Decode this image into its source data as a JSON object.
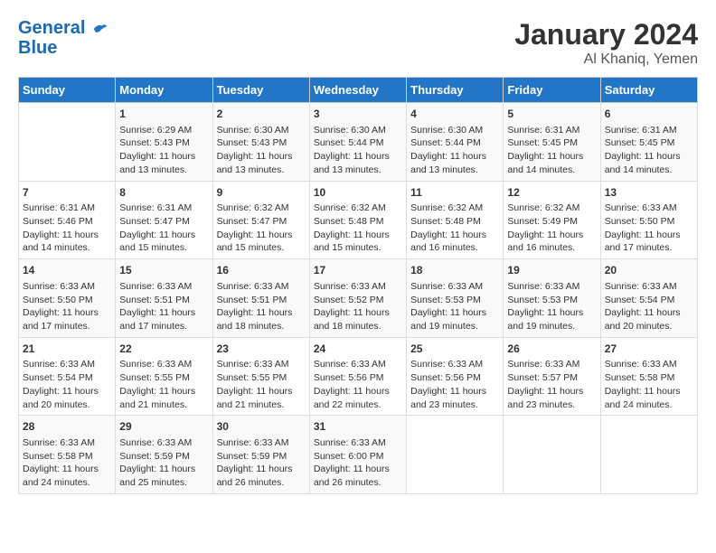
{
  "header": {
    "logo_line1": "General",
    "logo_line2": "Blue",
    "title": "January 2024",
    "subtitle": "Al Khaniq, Yemen"
  },
  "weekdays": [
    "Sunday",
    "Monday",
    "Tuesday",
    "Wednesday",
    "Thursday",
    "Friday",
    "Saturday"
  ],
  "weeks": [
    [
      {
        "day": "",
        "sunrise": "",
        "sunset": "",
        "daylight": ""
      },
      {
        "day": "1",
        "sunrise": "Sunrise: 6:29 AM",
        "sunset": "Sunset: 5:43 PM",
        "daylight": "Daylight: 11 hours and 13 minutes."
      },
      {
        "day": "2",
        "sunrise": "Sunrise: 6:30 AM",
        "sunset": "Sunset: 5:43 PM",
        "daylight": "Daylight: 11 hours and 13 minutes."
      },
      {
        "day": "3",
        "sunrise": "Sunrise: 6:30 AM",
        "sunset": "Sunset: 5:44 PM",
        "daylight": "Daylight: 11 hours and 13 minutes."
      },
      {
        "day": "4",
        "sunrise": "Sunrise: 6:30 AM",
        "sunset": "Sunset: 5:44 PM",
        "daylight": "Daylight: 11 hours and 13 minutes."
      },
      {
        "day": "5",
        "sunrise": "Sunrise: 6:31 AM",
        "sunset": "Sunset: 5:45 PM",
        "daylight": "Daylight: 11 hours and 14 minutes."
      },
      {
        "day": "6",
        "sunrise": "Sunrise: 6:31 AM",
        "sunset": "Sunset: 5:45 PM",
        "daylight": "Daylight: 11 hours and 14 minutes."
      }
    ],
    [
      {
        "day": "7",
        "sunrise": "Sunrise: 6:31 AM",
        "sunset": "Sunset: 5:46 PM",
        "daylight": "Daylight: 11 hours and 14 minutes."
      },
      {
        "day": "8",
        "sunrise": "Sunrise: 6:31 AM",
        "sunset": "Sunset: 5:47 PM",
        "daylight": "Daylight: 11 hours and 15 minutes."
      },
      {
        "day": "9",
        "sunrise": "Sunrise: 6:32 AM",
        "sunset": "Sunset: 5:47 PM",
        "daylight": "Daylight: 11 hours and 15 minutes."
      },
      {
        "day": "10",
        "sunrise": "Sunrise: 6:32 AM",
        "sunset": "Sunset: 5:48 PM",
        "daylight": "Daylight: 11 hours and 15 minutes."
      },
      {
        "day": "11",
        "sunrise": "Sunrise: 6:32 AM",
        "sunset": "Sunset: 5:48 PM",
        "daylight": "Daylight: 11 hours and 16 minutes."
      },
      {
        "day": "12",
        "sunrise": "Sunrise: 6:32 AM",
        "sunset": "Sunset: 5:49 PM",
        "daylight": "Daylight: 11 hours and 16 minutes."
      },
      {
        "day": "13",
        "sunrise": "Sunrise: 6:33 AM",
        "sunset": "Sunset: 5:50 PM",
        "daylight": "Daylight: 11 hours and 17 minutes."
      }
    ],
    [
      {
        "day": "14",
        "sunrise": "Sunrise: 6:33 AM",
        "sunset": "Sunset: 5:50 PM",
        "daylight": "Daylight: 11 hours and 17 minutes."
      },
      {
        "day": "15",
        "sunrise": "Sunrise: 6:33 AM",
        "sunset": "Sunset: 5:51 PM",
        "daylight": "Daylight: 11 hours and 17 minutes."
      },
      {
        "day": "16",
        "sunrise": "Sunrise: 6:33 AM",
        "sunset": "Sunset: 5:51 PM",
        "daylight": "Daylight: 11 hours and 18 minutes."
      },
      {
        "day": "17",
        "sunrise": "Sunrise: 6:33 AM",
        "sunset": "Sunset: 5:52 PM",
        "daylight": "Daylight: 11 hours and 18 minutes."
      },
      {
        "day": "18",
        "sunrise": "Sunrise: 6:33 AM",
        "sunset": "Sunset: 5:53 PM",
        "daylight": "Daylight: 11 hours and 19 minutes."
      },
      {
        "day": "19",
        "sunrise": "Sunrise: 6:33 AM",
        "sunset": "Sunset: 5:53 PM",
        "daylight": "Daylight: 11 hours and 19 minutes."
      },
      {
        "day": "20",
        "sunrise": "Sunrise: 6:33 AM",
        "sunset": "Sunset: 5:54 PM",
        "daylight": "Daylight: 11 hours and 20 minutes."
      }
    ],
    [
      {
        "day": "21",
        "sunrise": "Sunrise: 6:33 AM",
        "sunset": "Sunset: 5:54 PM",
        "daylight": "Daylight: 11 hours and 20 minutes."
      },
      {
        "day": "22",
        "sunrise": "Sunrise: 6:33 AM",
        "sunset": "Sunset: 5:55 PM",
        "daylight": "Daylight: 11 hours and 21 minutes."
      },
      {
        "day": "23",
        "sunrise": "Sunrise: 6:33 AM",
        "sunset": "Sunset: 5:55 PM",
        "daylight": "Daylight: 11 hours and 21 minutes."
      },
      {
        "day": "24",
        "sunrise": "Sunrise: 6:33 AM",
        "sunset": "Sunset: 5:56 PM",
        "daylight": "Daylight: 11 hours and 22 minutes."
      },
      {
        "day": "25",
        "sunrise": "Sunrise: 6:33 AM",
        "sunset": "Sunset: 5:56 PM",
        "daylight": "Daylight: 11 hours and 23 minutes."
      },
      {
        "day": "26",
        "sunrise": "Sunrise: 6:33 AM",
        "sunset": "Sunset: 5:57 PM",
        "daylight": "Daylight: 11 hours and 23 minutes."
      },
      {
        "day": "27",
        "sunrise": "Sunrise: 6:33 AM",
        "sunset": "Sunset: 5:58 PM",
        "daylight": "Daylight: 11 hours and 24 minutes."
      }
    ],
    [
      {
        "day": "28",
        "sunrise": "Sunrise: 6:33 AM",
        "sunset": "Sunset: 5:58 PM",
        "daylight": "Daylight: 11 hours and 24 minutes."
      },
      {
        "day": "29",
        "sunrise": "Sunrise: 6:33 AM",
        "sunset": "Sunset: 5:59 PM",
        "daylight": "Daylight: 11 hours and 25 minutes."
      },
      {
        "day": "30",
        "sunrise": "Sunrise: 6:33 AM",
        "sunset": "Sunset: 5:59 PM",
        "daylight": "Daylight: 11 hours and 26 minutes."
      },
      {
        "day": "31",
        "sunrise": "Sunrise: 6:33 AM",
        "sunset": "Sunset: 6:00 PM",
        "daylight": "Daylight: 11 hours and 26 minutes."
      },
      {
        "day": "",
        "sunrise": "",
        "sunset": "",
        "daylight": ""
      },
      {
        "day": "",
        "sunrise": "",
        "sunset": "",
        "daylight": ""
      },
      {
        "day": "",
        "sunrise": "",
        "sunset": "",
        "daylight": ""
      }
    ]
  ]
}
